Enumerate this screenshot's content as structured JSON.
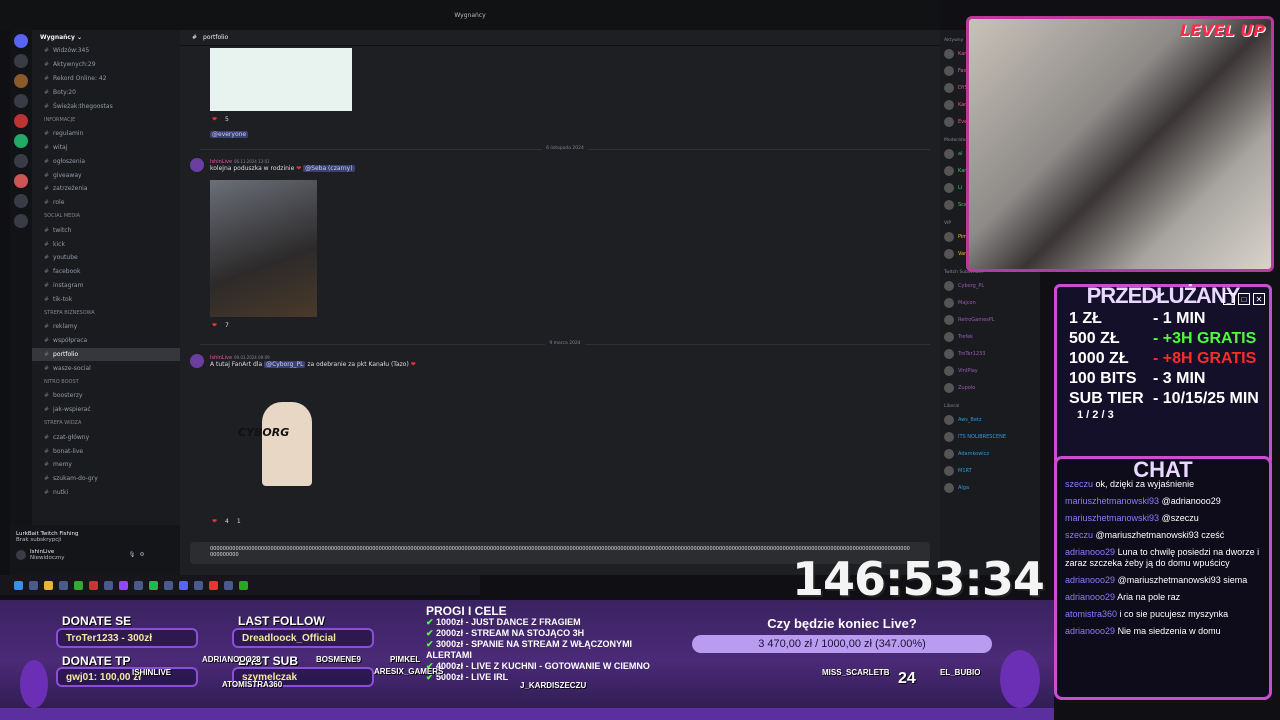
{
  "window": {
    "title": "Wygnańcy"
  },
  "server": {
    "name": "Wygnańcy"
  },
  "channels": [
    {
      "label": "Widzów:345",
      "type": "stat"
    },
    {
      "label": "Aktywnych:29",
      "type": "stat"
    },
    {
      "label": "Rekord Online: 42",
      "type": "stat"
    },
    {
      "label": "Boty:20",
      "type": "stat"
    },
    {
      "label": "Świeżak:thegoostas",
      "type": "stat"
    },
    {
      "label": "INFORMACJE",
      "type": "category"
    },
    {
      "label": "regulamin",
      "type": "text"
    },
    {
      "label": "witaj",
      "type": "text"
    },
    {
      "label": "ogłoszenia",
      "type": "text"
    },
    {
      "label": "giveaway",
      "type": "text"
    },
    {
      "label": "zatrzeżenia",
      "type": "text"
    },
    {
      "label": "role",
      "type": "text"
    },
    {
      "label": "SOCIAL MEDIA",
      "type": "category"
    },
    {
      "label": "twitch",
      "type": "text"
    },
    {
      "label": "kick",
      "type": "text"
    },
    {
      "label": "youtube",
      "type": "text"
    },
    {
      "label": "facebook",
      "type": "text"
    },
    {
      "label": "instagram",
      "type": "text"
    },
    {
      "label": "tik-tok",
      "type": "text"
    },
    {
      "label": "STREFA BIZNESOWA",
      "type": "category"
    },
    {
      "label": "reklamy",
      "type": "text"
    },
    {
      "label": "współpraca",
      "type": "text"
    },
    {
      "label": "portfolio",
      "type": "text",
      "active": true
    },
    {
      "label": "wasze-social",
      "type": "text"
    },
    {
      "label": "NITRO BOOST",
      "type": "category"
    },
    {
      "label": "boosterzy",
      "type": "text"
    },
    {
      "label": "jak-wspierać",
      "type": "text"
    },
    {
      "label": "STREFA WIDZA",
      "type": "category"
    },
    {
      "label": "czat-główny",
      "type": "text"
    },
    {
      "label": "bonat-live",
      "type": "text"
    },
    {
      "label": "memy",
      "type": "text"
    },
    {
      "label": "szukam-do-gry",
      "type": "text"
    },
    {
      "label": "nutki",
      "type": "text"
    }
  ],
  "activity": {
    "title": "LurkBait Twitch Fishing",
    "sub": "Brak subskrypcji"
  },
  "user": {
    "name": "IshinLive",
    "status": "Niewidoczny"
  },
  "chat": {
    "channel": "portfolio",
    "messages": [
      {
        "mention": "@everyone"
      },
      {
        "date": "6 listopada 2024",
        "author": "IshinLive",
        "time": "06.11.2024 13:01",
        "text": "kolejna poduszka w rodzinie",
        "mention": "@Seba (czarny)",
        "reaction": "7"
      },
      {
        "date": "9 marca 2024",
        "author": "IshinLive",
        "time": "09.03.2024 09:09",
        "text_pre": "A tutaj FanArt dla",
        "mention": "@Cyborg_PL",
        "text_post": "za odebranie za pkt Kanału (Tazo)",
        "reactions": [
          "4",
          "1"
        ]
      }
    ],
    "first_reaction": "5",
    "fanart_label": "CYBORG",
    "input_value": "0000000000000000000000000000000000000000000000000000000000000000000000000000000000000000000000000000000000000000000000000000000000000000000000000000000000000000000000000000000000000000000000000000000000000000000000000000000000000"
  },
  "members": {
    "groups": [
      {
        "label": "Aktywny",
        "items": [
          "Kamil",
          "Fast Food",
          "DYSMAN",
          "Kamil",
          "Everwind"
        ]
      },
      {
        "label": "Moderator",
        "items": [
          "al",
          "Kamil",
          "Li",
          "Scarlet"
        ]
      },
      {
        "label": "VIP",
        "items": [
          "Pimsel",
          "Vandher"
        ]
      },
      {
        "label": "Twitch Subscriber",
        "items": [
          "Cyborg_PL",
          "Majcon",
          "RetroGamesPL",
          "Trefek",
          "TroTer1233",
          "VinIPlay",
          "Zupolo"
        ]
      },
      {
        "label": "Liberal",
        "items": [
          "Aws_Betz",
          "ITS NOLIBRESCENE",
          "Adamkowicz",
          "M1RT",
          "Alga"
        ]
      }
    ]
  },
  "stream": {
    "logo": "LEVEL UP",
    "promo": {
      "title": "PRZEDŁUŻANY",
      "rows": [
        {
          "left": "1 ZŁ",
          "right": "- 1 MIN",
          "color": "#ffffff"
        },
        {
          "left": "500 ZŁ",
          "right": "- +3H GRATIS",
          "color": "#4cff3a"
        },
        {
          "left": "1000 ZŁ",
          "right": "- +8H GRATIS",
          "color": "#ff2b2b"
        },
        {
          "left": "100 BITS",
          "right": "- 3 MIN",
          "color": "#ffffff"
        },
        {
          "left": "SUB TIER",
          "right": "- 10/15/25 MIN",
          "color": "#ffffff"
        }
      ],
      "tiers": "1 / 2 / 3"
    },
    "chat_title": "CHAT",
    "chat_messages": [
      {
        "user": "szeczu",
        "text": "ok, dzięki za wyjaśnienie"
      },
      {
        "user": "mariuszhetmanowski93",
        "text": "@adrianooo29"
      },
      {
        "user": "mariuszhetmanowski93",
        "text": "@szeczu"
      },
      {
        "user": "szeczu",
        "text": "@mariuszhetmanowski93 cześć"
      },
      {
        "user": "adrianooo29",
        "text": "Luna to chwilę posiedzi na dworze i zaraz szczeka żeby ją do domu wpuścicy"
      },
      {
        "user": "adrianooo29",
        "text": "@mariuszhetmanowski93 siema"
      },
      {
        "user": "adrianooo29",
        "text": "Aria na pole raz"
      },
      {
        "user": "atomistra360",
        "text": "i co sie pucujesz myszynka"
      },
      {
        "user": "adrianooo29",
        "text": "Nie ma siedzenia w domu"
      }
    ],
    "timer": "146:53:34",
    "donate": {
      "title": "DONATE SE",
      "value": "TroTer1233 - 300zł"
    },
    "follow": {
      "title": "LAST FOLLOW",
      "value": "Dreadloock_Official"
    },
    "donate_tp": {
      "title": "DONATE TP",
      "value": "gwj01: 100,00 zł"
    },
    "last_sub": {
      "title": "LAST SUB",
      "value": "szymelczak"
    },
    "progi": {
      "title": "PROGI I CELE",
      "items": [
        "1000zł - JUST DANCE Z FRAGIEM",
        "2000zł - STREAM NA STOJĄCO 3H",
        "3000zł - SPANIE NA STREAM Z WŁĄCZONYMI ALERTAMI",
        "4000zł - LIVE Z KUCHNI - GOTOWANIE W CIEMNO",
        "5000zł - LIVE IRL"
      ]
    },
    "goal": {
      "question": "Czy będzie koniec Live?",
      "value": "3 470,00 zł / 1000,00 zł (347.00%)",
      "progress": 1.0
    },
    "names": [
      "ISHINLIVE",
      "ADRIANOOO29",
      "ATOMISTRA360",
      "BOSMENE9",
      "PIMKEL",
      "ARESIX_GAMERS",
      "J_KARDISZECZU",
      "MISS_SCARLETB",
      "EL_BUBIO"
    ],
    "counter": "24"
  }
}
